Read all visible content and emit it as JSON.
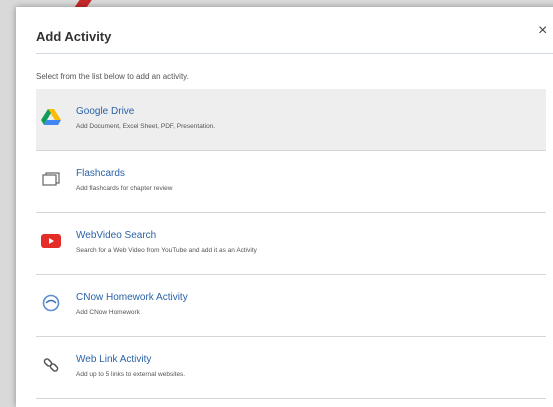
{
  "dialog": {
    "title": "Add Activity",
    "close_label": "×",
    "instruction": "Select from the list below to add an activity."
  },
  "activities": [
    {
      "name": "Google Drive",
      "description": "Add Document, Excel Sheet, PDF, Presentation.",
      "icon": "google-drive-icon",
      "selected": true
    },
    {
      "name": "Flashcards",
      "description": "Add flashcards for chapter review",
      "icon": "flashcards-icon",
      "selected": false
    },
    {
      "name": "WebVideo Search",
      "description": "Search for a Web Video from YouTube and add it as an Activity",
      "icon": "youtube-icon",
      "selected": false
    },
    {
      "name": "CNow Homework Activity",
      "description": "Add CNow Homework",
      "icon": "cnow-icon",
      "selected": false
    },
    {
      "name": "Web Link Activity",
      "description": "Add up to 5 links to external websites.",
      "icon": "link-icon",
      "selected": false
    }
  ],
  "colors": {
    "link": "#2a62a8",
    "selected_row": "#eeeeee",
    "pointer": "#c62828"
  }
}
